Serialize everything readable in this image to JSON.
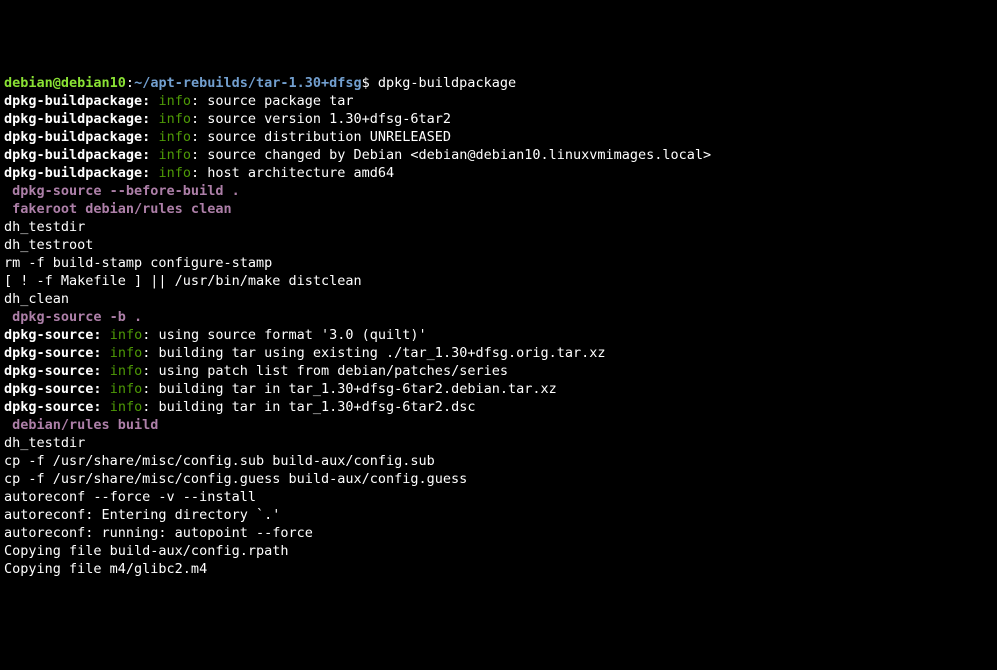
{
  "prompt": {
    "user": "debian@debian10",
    "colon": ":",
    "path": "~/apt-rebuilds/tar-1.30+dfsg",
    "dollar": "$ ",
    "cmd": "dpkg-buildpackage"
  },
  "lines": [
    {
      "type": "bpinfo",
      "prog": "dpkg-buildpackage:",
      "status": "info",
      "sep": ": ",
      "msg": "source package tar"
    },
    {
      "type": "bpinfo",
      "prog": "dpkg-buildpackage:",
      "status": "info",
      "sep": ": ",
      "msg": "source version 1.30+dfsg-6tar2"
    },
    {
      "type": "bpinfo",
      "prog": "dpkg-buildpackage:",
      "status": "info",
      "sep": ": ",
      "msg": "source distribution UNRELEASED"
    },
    {
      "type": "bpinfo",
      "prog": "dpkg-buildpackage:",
      "status": "info",
      "sep": ": ",
      "msg": "source changed by Debian <debian@debian10.linuxvmimages.local>"
    },
    {
      "type": "bpinfo",
      "prog": "dpkg-buildpackage:",
      "status": "info",
      "sep": ": ",
      "msg": "host architecture amd64"
    },
    {
      "type": "step",
      "text": " dpkg-source --before-build ."
    },
    {
      "type": "step",
      "text": " fakeroot debian/rules clean"
    },
    {
      "type": "plain",
      "text": "dh_testdir"
    },
    {
      "type": "plain",
      "text": "dh_testroot"
    },
    {
      "type": "plain",
      "text": "rm -f build-stamp configure-stamp"
    },
    {
      "type": "plain",
      "text": "[ ! -f Makefile ] || /usr/bin/make distclean"
    },
    {
      "type": "plain",
      "text": "dh_clean"
    },
    {
      "type": "step",
      "text": " dpkg-source -b ."
    },
    {
      "type": "bpinfo",
      "prog": "dpkg-source:",
      "status": "info",
      "sep": ": ",
      "msg": "using source format '3.0 (quilt)'"
    },
    {
      "type": "bpinfo",
      "prog": "dpkg-source:",
      "status": "info",
      "sep": ": ",
      "msg": "building tar using existing ./tar_1.30+dfsg.orig.tar.xz"
    },
    {
      "type": "bpinfo",
      "prog": "dpkg-source:",
      "status": "info",
      "sep": ": ",
      "msg": "using patch list from debian/patches/series"
    },
    {
      "type": "bpinfo",
      "prog": "dpkg-source:",
      "status": "info",
      "sep": ": ",
      "msg": "building tar in tar_1.30+dfsg-6tar2.debian.tar.xz"
    },
    {
      "type": "bpinfo",
      "prog": "dpkg-source:",
      "status": "info",
      "sep": ": ",
      "msg": "building tar in tar_1.30+dfsg-6tar2.dsc"
    },
    {
      "type": "step",
      "text": " debian/rules build"
    },
    {
      "type": "plain",
      "text": "dh_testdir"
    },
    {
      "type": "plain",
      "text": "cp -f /usr/share/misc/config.sub build-aux/config.sub"
    },
    {
      "type": "plain",
      "text": "cp -f /usr/share/misc/config.guess build-aux/config.guess"
    },
    {
      "type": "plain",
      "text": "autoreconf --force -v --install"
    },
    {
      "type": "plain",
      "text": "autoreconf: Entering directory `.'"
    },
    {
      "type": "plain",
      "text": "autoreconf: running: autopoint --force"
    },
    {
      "type": "plain",
      "text": "Copying file build-aux/config.rpath"
    },
    {
      "type": "plain",
      "text": "Copying file m4/glibc2.m4"
    }
  ]
}
